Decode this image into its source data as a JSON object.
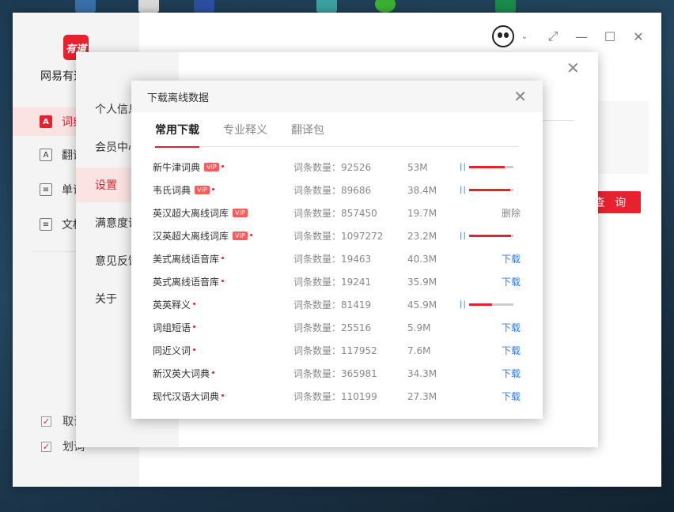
{
  "app": {
    "logo_text": "有道",
    "name": "网易有道词典",
    "nav": [
      {
        "label": "词典",
        "icon": "A"
      },
      {
        "label": "翻译",
        "icon": "A"
      },
      {
        "label": "单词本",
        "icon": "≡"
      },
      {
        "label": "文档翻译",
        "icon": "≡"
      }
    ],
    "checks": [
      "取词",
      "划词"
    ],
    "query_button": "查 询"
  },
  "settings": {
    "items": [
      "个人信息",
      "会员中心",
      "设置",
      "满意度调查",
      "意见反馈",
      "关于"
    ],
    "active_index": 2
  },
  "download_dialog": {
    "title": "下载离线数据",
    "tabs": [
      "常用下载",
      "专业释义",
      "翻译包"
    ],
    "active_tab": 0,
    "vip_label": "VIP",
    "download_label": "下载",
    "delete_label": "删除",
    "pause_glyph": "| |",
    "rows": [
      {
        "name": "新牛津词典",
        "vip": true,
        "dot": true,
        "count": "词条数量：92526",
        "size": "53M",
        "status": "progress",
        "progress": 0.8
      },
      {
        "name": "韦氏词典",
        "vip": true,
        "dot": true,
        "count": "词条数量：89686",
        "size": "38.4M",
        "status": "progress",
        "progress": 0.93
      },
      {
        "name": "英汉超大离线词库",
        "vip": true,
        "dot": false,
        "count": "词条数量：857450",
        "size": "19.7M",
        "status": "delete"
      },
      {
        "name": "汉英超大离线词库",
        "vip": true,
        "dot": true,
        "count": "词条数量：1097272",
        "size": "23.2M",
        "status": "progress",
        "progress": 0.95
      },
      {
        "name": "美式离线语音库",
        "vip": false,
        "dot": true,
        "count": "词条数量：19463",
        "size": "40.3M",
        "status": "download"
      },
      {
        "name": "英式离线语音库",
        "vip": false,
        "dot": true,
        "count": "词条数量：19241",
        "size": "35.9M",
        "status": "download"
      },
      {
        "name": "英英释义",
        "vip": false,
        "dot": true,
        "count": "词条数量：81419",
        "size": "45.9M",
        "status": "progress",
        "progress": 0.52
      },
      {
        "name": "词组短语",
        "vip": false,
        "dot": true,
        "count": "词条数量：25516",
        "size": "5.9M",
        "status": "download"
      },
      {
        "name": "同近义词",
        "vip": false,
        "dot": true,
        "count": "词条数量：117952",
        "size": "7.6M",
        "status": "download"
      },
      {
        "name": "新汉英大词典",
        "vip": false,
        "dot": true,
        "count": "词条数量：365981",
        "size": "34.3M",
        "status": "download"
      },
      {
        "name": "现代汉语大词典",
        "vip": false,
        "dot": true,
        "count": "词条数量：110199",
        "size": "27.3M",
        "status": "download"
      }
    ]
  }
}
